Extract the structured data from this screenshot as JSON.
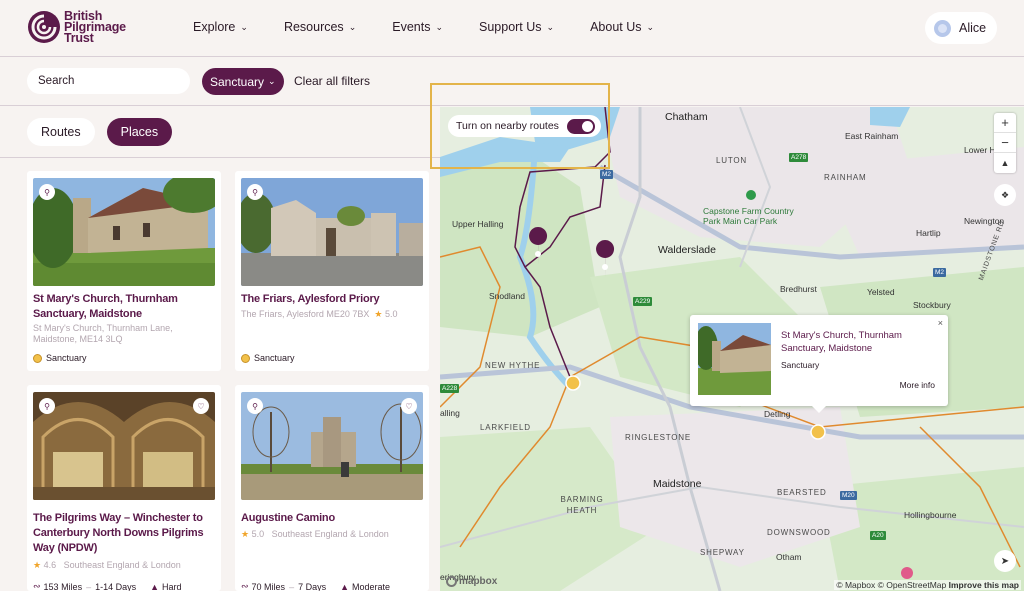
{
  "header": {
    "logo_lines": [
      "British",
      "Pilgrimage",
      "Trust"
    ],
    "nav": [
      {
        "label": "Explore"
      },
      {
        "label": "Resources"
      },
      {
        "label": "Events"
      },
      {
        "label": "Support Us"
      },
      {
        "label": "About Us"
      }
    ],
    "user": {
      "name": "Alice"
    }
  },
  "filters": {
    "search_placeholder": "Search",
    "active_chip": "Sanctuary",
    "clear_label": "Clear all filters"
  },
  "view_toggle": {
    "routes_label": "Routes",
    "places_label": "Places",
    "active": "Places"
  },
  "cards": [
    {
      "title": "St Mary's Church, Thurnham Sanctuary, Maidstone",
      "address": "St Mary's Church, Thurnham Lane, Maidstone, ME14 3LQ",
      "tag": "Sanctuary"
    },
    {
      "title": "The Friars, Aylesford Priory",
      "address": "The Friars, Aylesford ME20 7BX",
      "rating": "5.0",
      "tag": "Sanctuary"
    },
    {
      "title": "The Pilgrims Way – Winchester to Canterbury North Downs Pilgrims Way (NPDW)",
      "rating": "4.6",
      "region": "Southeast England & London",
      "distance": "153 Miles",
      "duration": "1-14 Days",
      "difficulty": "Hard"
    },
    {
      "title": "Augustine Camino",
      "rating": "5.0",
      "region": "Southeast England & London",
      "distance": "70 Miles",
      "duration": "7 Days",
      "difficulty": "Moderate"
    }
  ],
  "map": {
    "nearby_toggle_label": "Turn on nearby routes",
    "nearby_on": true,
    "labels": {
      "chatham": "Chatham",
      "luton": "LUTON",
      "rainham": "RAINHAM",
      "east_rainham": "East Rainham",
      "lower_h": "Lower H",
      "upper_halling": "Upper Halling",
      "capstone": "Capstone Farm Country Park Main Car Park",
      "walderslade": "Walderslade",
      "hartlip": "Hartlip",
      "newington": "Newington",
      "snodland": "Snodland",
      "bredhurst": "Bredhurst",
      "yelsted": "Yelsted",
      "stockbury": "Stockbury",
      "new_hythe": "NEW HYTHE",
      "larkfield": "LARKFIELD",
      "alling": "alling",
      "detling": "Detling",
      "ringlestone": "RINGLESTONE",
      "maidstone": "Maidstone",
      "bearsted": "BEARSTED",
      "barming_heath": "BARMING HEATH",
      "downswood": "DOWNSWOOD",
      "hollingbourne": "Hollingbourne",
      "shepway": "SHEPWAY",
      "otham": "Otham",
      "eringbury": "eringbury",
      "maidstone_rd": "MAIDSTONE RD"
    },
    "roads": {
      "m2a": "M2",
      "m2b": "M2",
      "a229": "A229",
      "a228": "A228",
      "a278": "A278",
      "m20": "M20",
      "a20": "A20"
    },
    "popup": {
      "title": "St Mary's Church, Thurnham Sanctuary, Maidstone",
      "tag": "Sanctuary",
      "more": "More info",
      "close": "×"
    },
    "attribution": {
      "mapbox": "© Mapbox",
      "osm": "© OpenStreetMap",
      "improve": "Improve this map"
    },
    "logo_text": "mapbox"
  },
  "colors": {
    "brand": "#5b1a4a",
    "background": "#f7f3f1",
    "highlight": "#e3b44a"
  }
}
